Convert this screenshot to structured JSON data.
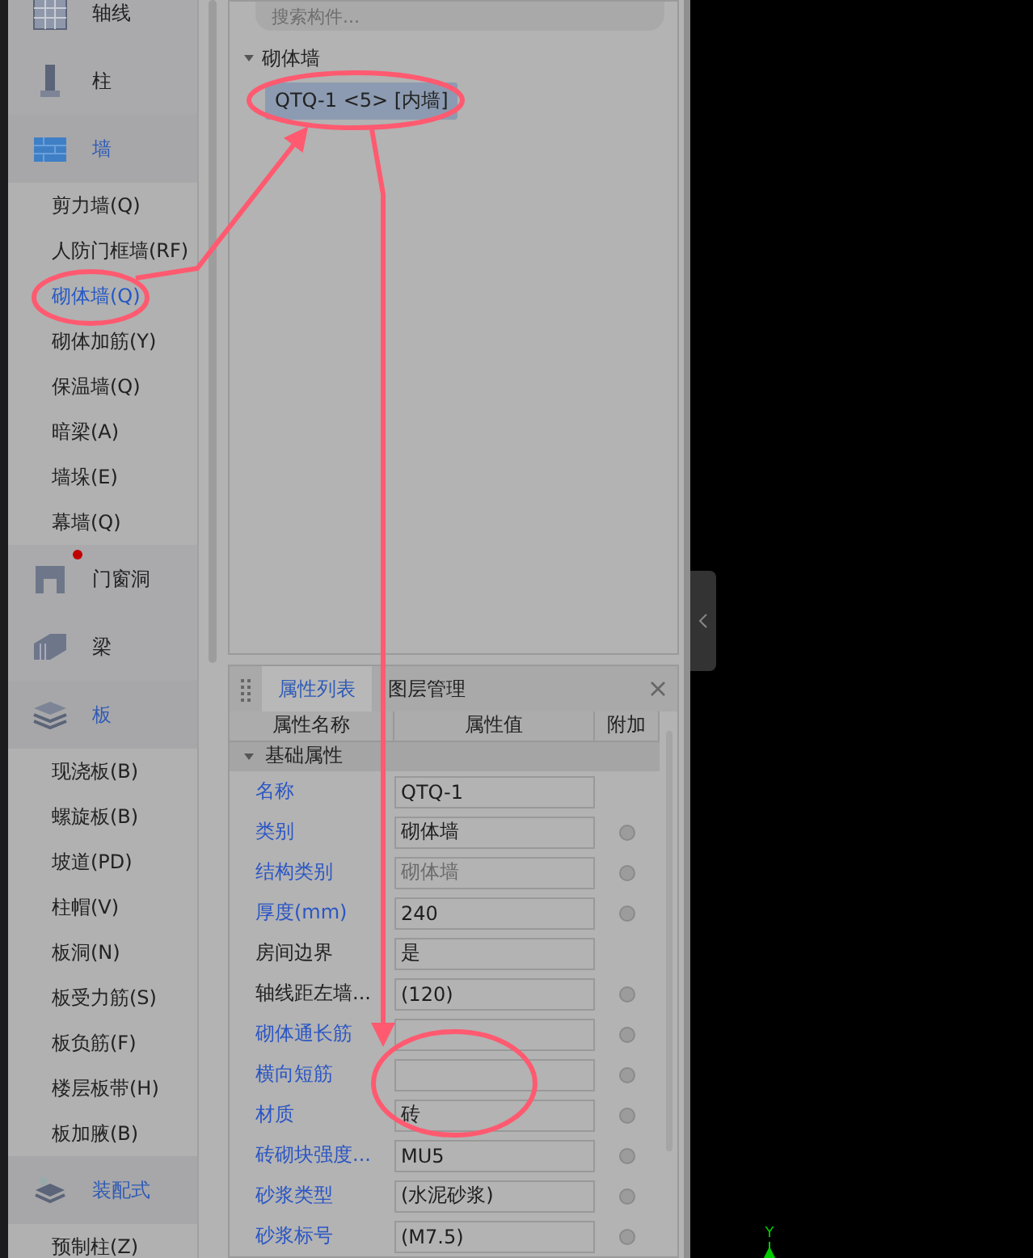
{
  "sidebar": {
    "categories": [
      {
        "label": "轴线",
        "expanded": false
      },
      {
        "label": "柱",
        "expanded": false
      },
      {
        "label": "墙",
        "expanded": true,
        "children": [
          {
            "label": "剪力墙(Q)",
            "selected": false
          },
          {
            "label": "人防门框墙(RF)",
            "selected": false
          },
          {
            "label": "砌体墙(Q)",
            "selected": true
          },
          {
            "label": "砌体加筋(Y)",
            "selected": false
          },
          {
            "label": "保温墙(Q)",
            "selected": false
          },
          {
            "label": "暗梁(A)",
            "selected": false
          },
          {
            "label": "墙垛(E)",
            "selected": false
          },
          {
            "label": "幕墙(Q)",
            "selected": false
          }
        ]
      },
      {
        "label": "门窗洞",
        "expanded": false,
        "badge": true
      },
      {
        "label": "梁",
        "expanded": false
      },
      {
        "label": "板",
        "expanded": true,
        "children": [
          {
            "label": "现浇板(B)",
            "selected": false
          },
          {
            "label": "螺旋板(B)",
            "selected": false
          },
          {
            "label": "坡道(PD)",
            "selected": false
          },
          {
            "label": "柱帽(V)",
            "selected": false
          },
          {
            "label": "板洞(N)",
            "selected": false
          },
          {
            "label": "板受力筋(S)",
            "selected": false
          },
          {
            "label": "板负筋(F)",
            "selected": false
          },
          {
            "label": "楼层板带(H)",
            "selected": false
          },
          {
            "label": "板加腋(B)",
            "selected": false
          }
        ]
      },
      {
        "label": "装配式",
        "expanded": true,
        "children": [
          {
            "label": "预制柱(Z)",
            "selected": false
          }
        ]
      }
    ]
  },
  "component_tree": {
    "search": {
      "placeholder": "搜索构件..."
    },
    "group": {
      "label": "砌体墙",
      "expanded": true,
      "items": [
        {
          "label": "QTQ-1 <5> [内墙]",
          "selected": true
        }
      ]
    }
  },
  "property_panel": {
    "tabs": [
      {
        "label": "属性列表",
        "selected": true
      },
      {
        "label": "图层管理",
        "selected": false
      }
    ],
    "columns": [
      "属性名称",
      "属性值",
      "附加"
    ],
    "section": {
      "label": "基础属性",
      "expanded": true
    },
    "rows": [
      {
        "name": "名称",
        "public": true,
        "value": "QTQ-1",
        "disabled": false,
        "extra": false
      },
      {
        "name": "类别",
        "public": true,
        "value": "砌体墙",
        "disabled": false,
        "extra": true
      },
      {
        "name": "结构类别",
        "public": true,
        "value": "砌体墙",
        "disabled": true,
        "extra": true
      },
      {
        "name": "厚度(mm)",
        "public": true,
        "value": "240",
        "disabled": false,
        "extra": true
      },
      {
        "name": "房间边界",
        "public": false,
        "value": "是",
        "disabled": false,
        "extra": false
      },
      {
        "name": "轴线距左墙...",
        "public": false,
        "value": "(120)",
        "disabled": false,
        "extra": true
      },
      {
        "name": "砌体通长筋",
        "public": true,
        "value": "",
        "disabled": false,
        "extra": true
      },
      {
        "name": "横向短筋",
        "public": true,
        "value": "",
        "disabled": false,
        "extra": true
      },
      {
        "name": "材质",
        "public": true,
        "value": "砖",
        "disabled": false,
        "extra": true
      },
      {
        "name": "砖砌块强度...",
        "public": true,
        "value": "MU5",
        "disabled": false,
        "extra": true
      },
      {
        "name": "砂浆类型",
        "public": true,
        "value": "(水泥砂浆)",
        "disabled": false,
        "extra": true
      },
      {
        "name": "砂浆标号",
        "public": true,
        "value": "(M7.5)",
        "disabled": false,
        "extra": true
      }
    ]
  },
  "viewport": {
    "axis_label": "Y"
  }
}
